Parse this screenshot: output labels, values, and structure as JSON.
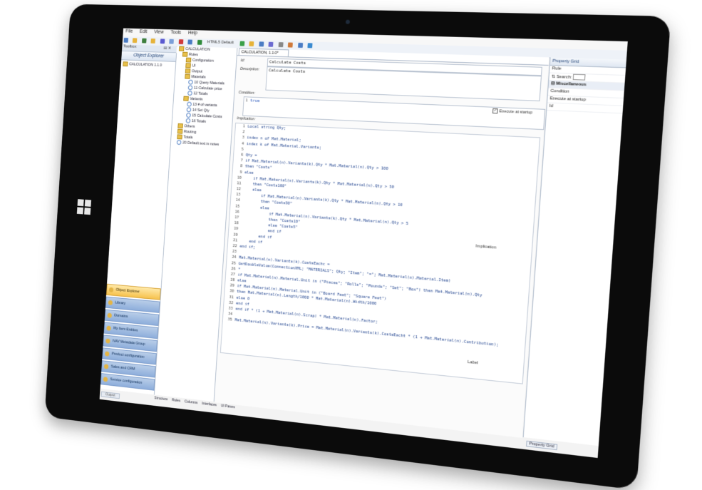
{
  "menubar": {
    "items": [
      "File",
      "Edit",
      "View",
      "Tools",
      "Help"
    ]
  },
  "toolbar": {
    "theme_label": "HTML5 Default"
  },
  "toolbox": {
    "title": "Toolbox",
    "pin": "⊞ ✕"
  },
  "object_explorer": {
    "title": "Object Explorer",
    "root": "CALCULATION 1.1.0"
  },
  "nav": {
    "items": [
      "Object Explorer",
      "Library",
      "Domains",
      "My Item Entities",
      "NAV Metadata Group",
      "Product configuration",
      "Sales and CRM configuration",
      "Service configuration"
    ]
  },
  "tree": {
    "rows": [
      {
        "label": "CALCULATION",
        "type": "root",
        "indent": 0
      },
      {
        "label": "Rules",
        "type": "folder",
        "indent": 1
      },
      {
        "label": "Configuration",
        "type": "folder",
        "indent": 2
      },
      {
        "label": "UI",
        "type": "folder",
        "indent": 2
      },
      {
        "label": "Output",
        "type": "folder",
        "indent": 2
      },
      {
        "label": "Materials",
        "type": "folder",
        "indent": 2
      },
      {
        "label": "10 Query Materials",
        "type": "rule",
        "indent": 3
      },
      {
        "label": "11 Calculate price",
        "type": "rule",
        "indent": 3
      },
      {
        "label": "12 Totals",
        "type": "rule",
        "indent": 3
      },
      {
        "label": "Variants",
        "type": "folder",
        "indent": 2
      },
      {
        "label": "13 # of variants",
        "type": "rule",
        "indent": 3
      },
      {
        "label": "14 Set Qty",
        "type": "rule",
        "indent": 3
      },
      {
        "label": "15 Calculate Costs",
        "type": "rule",
        "indent": 3
      },
      {
        "label": "16 Totals",
        "type": "rule",
        "indent": 3
      },
      {
        "label": "Others",
        "type": "folder",
        "indent": 1
      },
      {
        "label": "Routing",
        "type": "folder",
        "indent": 1
      },
      {
        "label": "Totals",
        "type": "folder",
        "indent": 1
      },
      {
        "label": "20 Default text in notes",
        "type": "rule",
        "indent": 1
      }
    ]
  },
  "editor": {
    "tab_title": "CALCULATION, 1.1.0*",
    "id_label": "Id:",
    "id_value": "Calculate Costs",
    "description_label": "Description:",
    "description_value": "Calculate Costs",
    "condition_label": "Condition:",
    "condition_value": "true",
    "execute_label": "Execute at startup",
    "execute_checked": "✓",
    "implication_label": "Implication:",
    "code_lines": [
      "Local string Qty;",
      "",
      "index n of Mat.Material;",
      "index k of Mat.Material.Variants;",
      "",
      "Qty =",
      "if Mat.Material(n).Variants(k).Qty * Mat.Material(n).Qty > 100",
      "then \"Costs\"",
      "else",
      "    if Mat.Material(n).Variants(k).Qty * Mat.Material(n).Qty > 50",
      "    then \"Costs100\"",
      "    else",
      "        if Mat.Material(n).Variants(k).Qty * Mat.Material(n).Qty > 10",
      "        then \"Costs50\"",
      "        else",
      "            if Mat.Material(n).Variants(k).Qty * Mat.Material(n).Qty > 5",
      "            then \"Costs10\"",
      "            else \"Costs5\"",
      "            end if",
      "        end if",
      "    end if",
      "end if;",
      "",
      "Mat.Material(n).Variants(k).CostsEachc =",
      "GetDoubleValue(ConnectionXML; \"MATERIALS\"; Qty; \"Item\"; \"=\"; Mat.Material(n).Material.Item)",
      "*",
      "if Mat.Material(n).Material.Unit in (\"Pieces\"; \"Rolls\"; \"Pounds\"; \"Set\"; \"Box\") then Mat.Material(n).Qty",
      "else",
      "if Mat.Material(n).Material.Unit in (\"Board Feet\"; \"Square Feet\")",
      "then Mat.Material(n).Length/1000 * Mat.Material(n).Width/1000",
      "else 0",
      "end if",
      "end if * (1 + Mat.Material(n).Scrap) * Mat.Material(n).Factor;",
      "",
      "Mat.Material(n).Variants(k).Price = Mat.Material(n).Variants(k).CostsEacht * (1 + Mat.Material(n).Contribution);"
    ],
    "implication_side": "Implication",
    "label_side": "Label"
  },
  "property_grid": {
    "title": "Property Grid",
    "selected": "Rule",
    "search_label": "Search:",
    "category": "Miscellaneous",
    "rows": [
      "Condition",
      "Execute at startup",
      "Id"
    ],
    "bottom_tab": "Property Grid"
  },
  "bottom_tabs": [
    "Structure",
    "Rules",
    "Columns",
    "Interfaces",
    "UI Panes"
  ],
  "output_tab": "Output"
}
